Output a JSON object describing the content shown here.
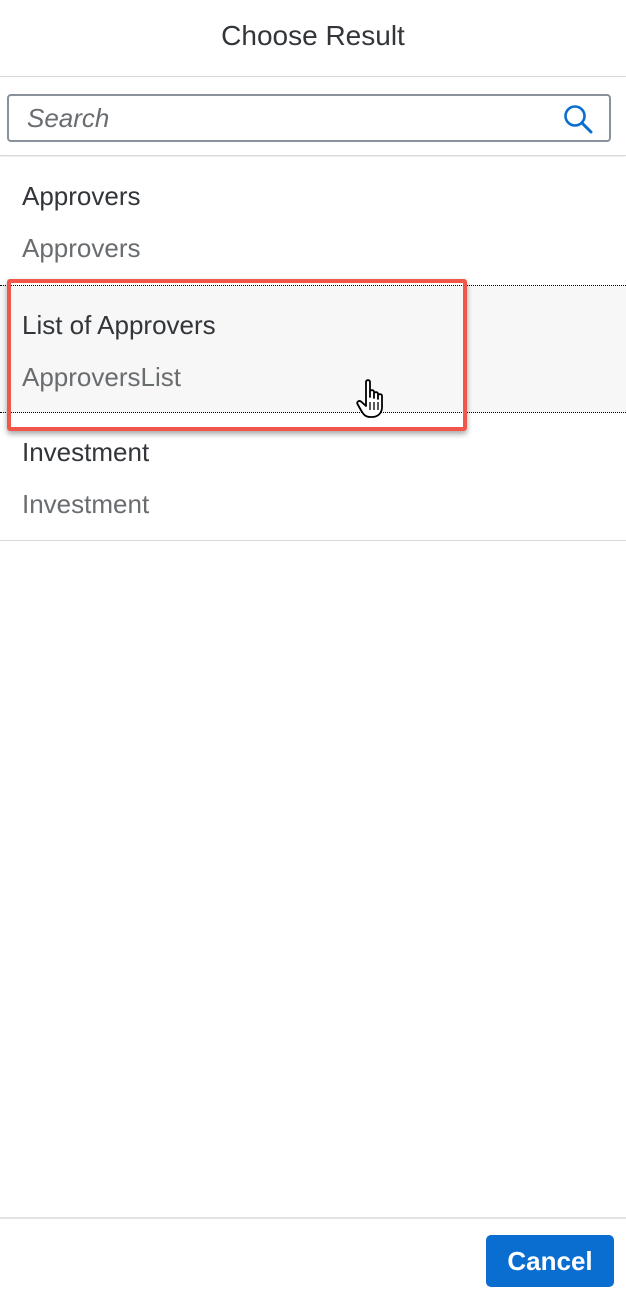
{
  "dialog": {
    "title": "Choose Result"
  },
  "search": {
    "placeholder": "Search",
    "value": "",
    "icon": "search-icon"
  },
  "results": [
    {
      "title": "Approvers",
      "description": "Approvers",
      "hovered": false
    },
    {
      "title": "List of Approvers",
      "description": "ApproversList",
      "hovered": true
    },
    {
      "title": "Investment",
      "description": "Investment",
      "hovered": false
    }
  ],
  "footer": {
    "cancel_label": "Cancel"
  },
  "colors": {
    "accent": "#0a6ed1",
    "highlight": "#f0564a",
    "text_primary": "#32363a",
    "text_secondary": "#6a6d70"
  }
}
